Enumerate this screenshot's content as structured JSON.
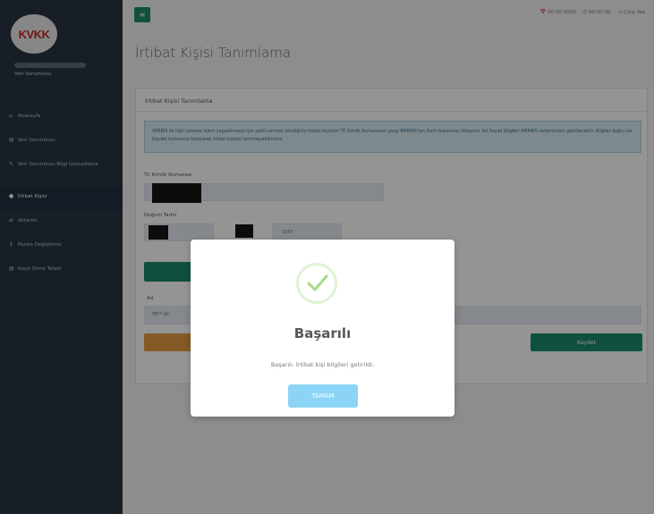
{
  "logo": {
    "text": "KVKK"
  },
  "user": {
    "role": "Veri Sorumlusu"
  },
  "sidebar": {
    "items": [
      {
        "icon": "home-icon",
        "label": "Anasayfa"
      },
      {
        "icon": "file-icon",
        "label": "Veri Sorumlusu"
      },
      {
        "icon": "edit-icon",
        "label": "Veri Sorumlusu Bilgi Güncelleme"
      },
      {
        "icon": "user-icon",
        "label": "İrtibat Kişisi"
      },
      {
        "icon": "exchange-icon",
        "label": "Aktarım"
      },
      {
        "icon": "key-icon",
        "label": "Parola Değiştirme"
      },
      {
        "icon": "file-icon",
        "label": "Kayıt Silme Talebi"
      }
    ]
  },
  "topbar": {
    "menu_icon": "≡",
    "date": "📅 00.00.0000",
    "time": "⏱ 00:00:00",
    "logout": "⇥ Çıkış Yap"
  },
  "page": {
    "title": "İrtibat Kişisi Tanımlama",
    "panel_heading": "İrtibat Kişisi Tanımlama",
    "info_text": "VERBİS ile ilgili sisteme işlem yapabilmeniz için yetki vermek istediğiniz irtibat kişisinin TC Kimlik Numarasını yazıp MERNİS'ten Getir butonuna tıklayınız. Ad Soyad bilgileri MERNİS sisteminden getirilecektir. Bilgiler doğru ise Kaydet butonuna tıklayarak irtibat kişisini tanımlayabilirsiniz.",
    "tc_label": "TC Kimlik Numarası",
    "dob_label": "Doğum Tarihi",
    "year_value": "1987",
    "name_label": "Ad",
    "name_value": "TE** AY",
    "save_label": "Kaydet"
  },
  "modal": {
    "title": "Başarılı",
    "message": "Başarılı. İrtibat kişi bilgileri getirildi.",
    "ok_label": "TAMAM"
  }
}
